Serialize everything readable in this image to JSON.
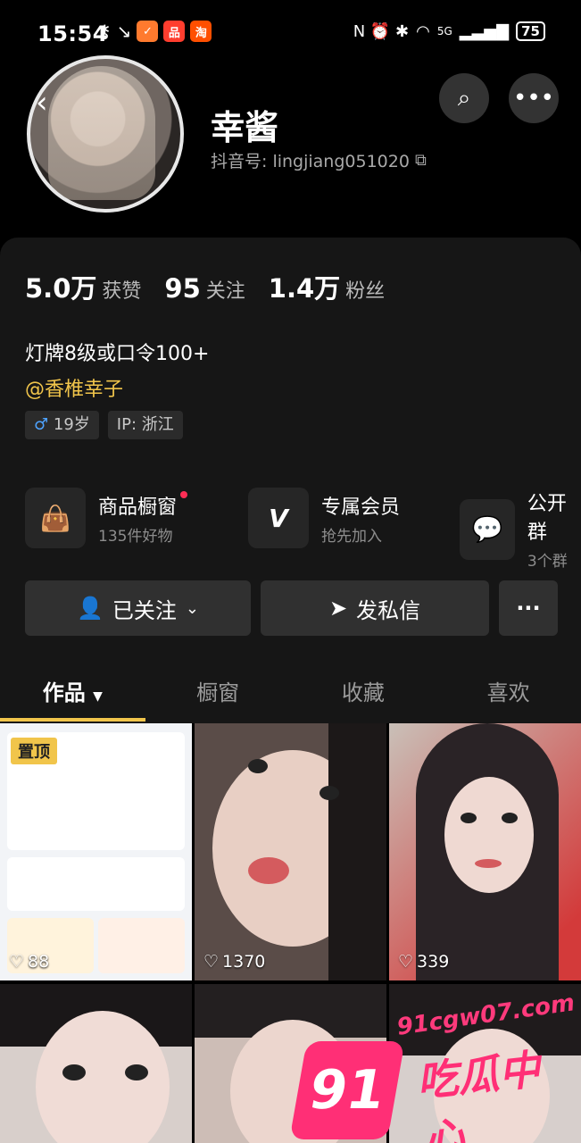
{
  "status_bar": {
    "time": "15:54",
    "left_icons": [
      "key-icon",
      "missed-call-icon"
    ],
    "app_badges": [
      {
        "name": "shopping-app",
        "color": "#ff7a2e",
        "glyph": "✓"
      },
      {
        "name": "pinduoduo-app",
        "color": "#ff3d2e",
        "glyph": "品"
      },
      {
        "name": "taobao-app",
        "color": "#ff4f00",
        "glyph": "淘"
      }
    ],
    "right_text": "N ⏰ ✱",
    "network": "5G",
    "battery": "75"
  },
  "profile": {
    "nickname": "幸酱",
    "douyin_id": "抖音号: lingjiang051020",
    "stats": [
      {
        "num": "5.0万",
        "label": "获赞"
      },
      {
        "num": "95",
        "label": "关注"
      },
      {
        "num": "1.4万",
        "label": "粉丝"
      }
    ],
    "bio": "灯牌8级或口令100+",
    "mention": "@香椎幸子",
    "tags": [
      {
        "icon": "♂",
        "text": "19岁"
      },
      {
        "icon": "",
        "text": "IP: 浙江"
      }
    ]
  },
  "services": [
    {
      "icon": "bag-icon",
      "title": "商品橱窗",
      "sub": "135件好物",
      "dot": true
    },
    {
      "icon": "v-icon",
      "title": "专属会员",
      "sub": "抢先加入",
      "dot": false
    },
    {
      "icon": "chat-icon",
      "title": "公开群",
      "sub": "3个群",
      "dot": false
    }
  ],
  "actions": {
    "follow": "已关注",
    "message": "发私信",
    "more": "···"
  },
  "tabs": [
    "作品",
    "橱窗",
    "收藏",
    "喜欢"
  ],
  "videos": [
    {
      "likes": "88",
      "pinned": "置顶"
    },
    {
      "likes": "1370"
    },
    {
      "likes": "339"
    },
    {
      "likes": ""
    },
    {
      "likes": ""
    },
    {
      "likes": ""
    }
  ],
  "watermark": {
    "url": "91cgw07.com",
    "logo": "91",
    "title": "吃瓜中心"
  }
}
